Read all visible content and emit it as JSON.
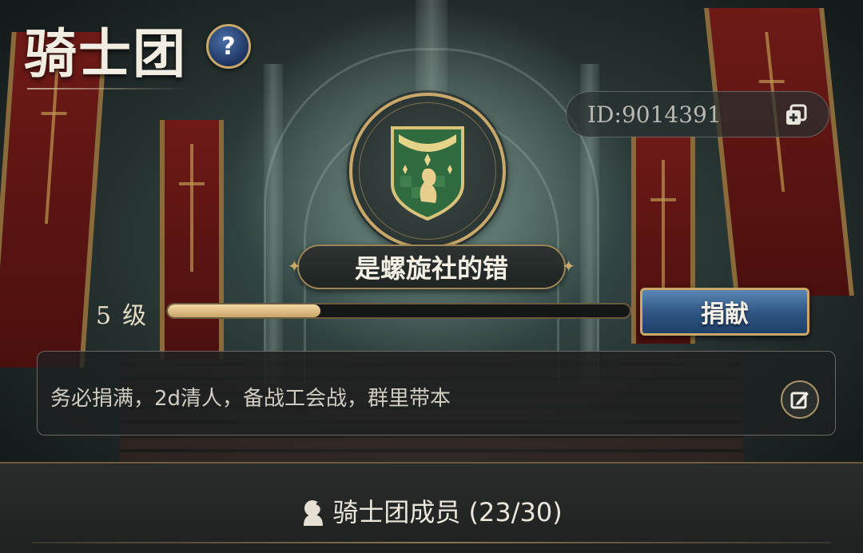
{
  "header": {
    "title": "骑士团",
    "help_icon": "question-mark-icon"
  },
  "guild": {
    "id_label": "ID:9014391",
    "copy_icon": "copy-icon",
    "emblem_icon": "shield-emblem-icon",
    "name": "是螺旋社的错",
    "level_number": "5",
    "level_unit": "级",
    "exp_progress": 0.33
  },
  "actions": {
    "donate_label": "捐献",
    "edit_icon": "edit-icon"
  },
  "notice": {
    "text": "务必捐满，2d清人，备战工会战，群里带本"
  },
  "members": {
    "label": "骑士团成员 (23/30)",
    "icon": "member-silhouette-icon"
  },
  "colors": {
    "gold_accent": "#c9a86a",
    "progress_fill": "#f3d9a3",
    "donate_button": "#2d5481",
    "emblem_green": "#2f6b3e"
  }
}
